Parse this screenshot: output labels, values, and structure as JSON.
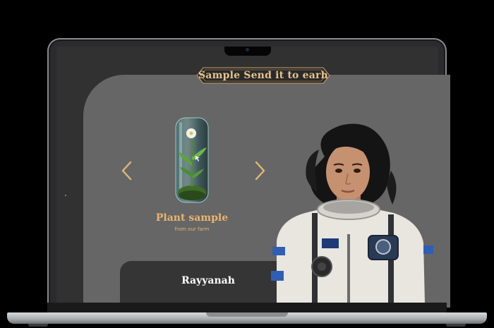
{
  "banner": {
    "title": "Sample Send it to earh"
  },
  "carousel": {
    "prev_icon": "chevron-left-icon",
    "next_icon": "chevron-right-icon",
    "item": {
      "title": "Plant sample",
      "subtitle": "from our farm",
      "image": "plant-in-glass-jar"
    }
  },
  "profile": {
    "name": "Rayyanah",
    "image": "astronaut-portrait"
  },
  "colors": {
    "accent_gold": "#e9b56b",
    "panel": "#666667",
    "screen_bg": "#313132",
    "card_bg": "#353536"
  }
}
